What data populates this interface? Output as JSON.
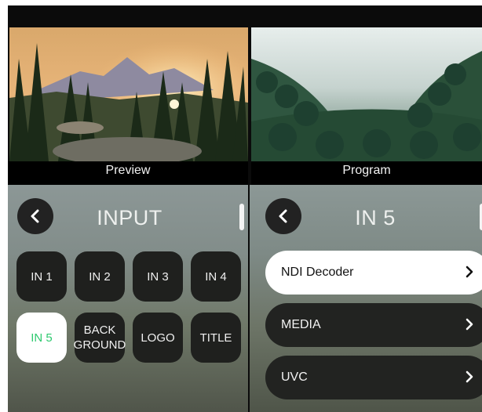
{
  "preview": {
    "label": "Preview"
  },
  "program": {
    "label": "Program"
  },
  "input_panel": {
    "title": "INPUT",
    "sources": [
      {
        "id": "in1",
        "label": "IN 1",
        "active": false
      },
      {
        "id": "in2",
        "label": "IN 2",
        "active": false
      },
      {
        "id": "in3",
        "label": "IN 3",
        "active": false
      },
      {
        "id": "in4",
        "label": "IN 4",
        "active": false
      },
      {
        "id": "in5",
        "label": "IN 5",
        "active": true
      },
      {
        "id": "background",
        "label": "BACK\nGROUND",
        "active": false
      },
      {
        "id": "logo",
        "label": "LOGO",
        "active": false
      },
      {
        "id": "title",
        "label": "TITLE",
        "active": false
      }
    ]
  },
  "in5_panel": {
    "title": "IN 5",
    "options": [
      {
        "label": "NDI Decoder",
        "selected": true
      },
      {
        "label": "MEDIA",
        "selected": false
      },
      {
        "label": "UVC",
        "selected": false
      }
    ]
  },
  "colors": {
    "active_text": "#2ec96f",
    "tile_bg": "#1f201e",
    "selected_bg": "#ffffff"
  },
  "icons": {
    "back": "chevron-left-icon",
    "option_arrow": "chevron-right-icon"
  }
}
